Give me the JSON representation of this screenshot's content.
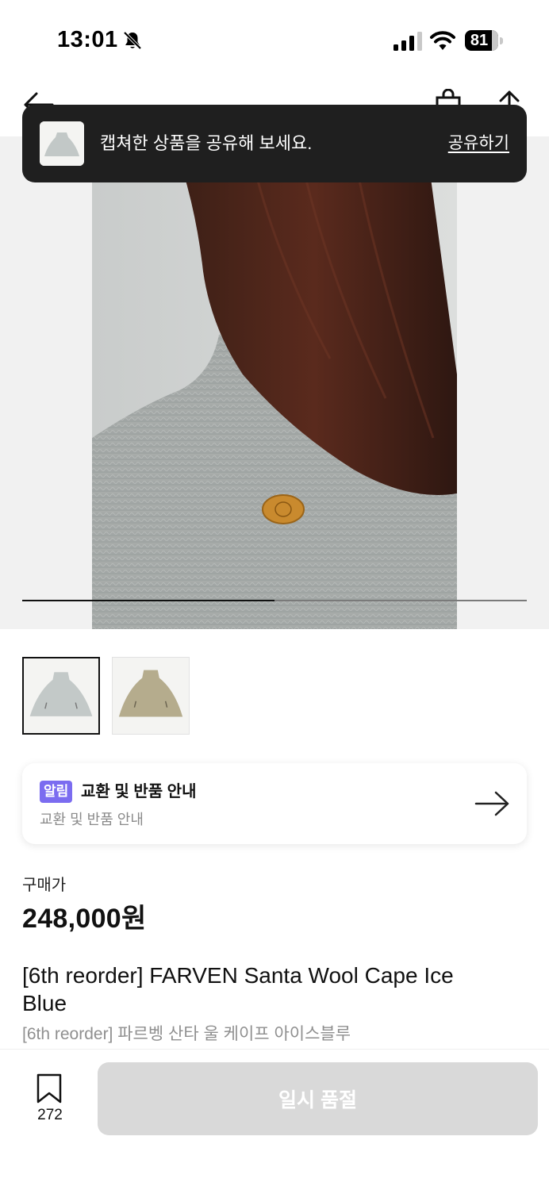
{
  "status_bar": {
    "time": "13:01",
    "battery": "81",
    "battery_level": 0.81
  },
  "nav": {
    "back_icon": "arrow-left-icon",
    "bag_icon": "shopping-bag-icon",
    "share_icon": "share-icon"
  },
  "gallery": {
    "progress": 0.5,
    "thumbnails": [
      {
        "name": "ice-blue-cape",
        "selected": true
      },
      {
        "name": "beige-cape",
        "selected": false
      }
    ]
  },
  "toast": {
    "message": "캡쳐한 상품을 공유해 보세요.",
    "action": "공유하기"
  },
  "notice": {
    "badge": "알림",
    "title": "교환 및 반품 안내",
    "subtitle": "교환 및 반품 안내"
  },
  "product": {
    "price_label": "구매가",
    "price": "248,000원",
    "title": "[6th reorder] FARVEN Santa Wool Cape Ice Blue",
    "subtitle": "[6th reorder] 파르벵 산타 울 케이프 아이스블루"
  },
  "bottom_bar": {
    "bookmark_count": "272",
    "cta_label": "일시 품절"
  },
  "colors": {
    "accent_badge": "#7b6cf0",
    "toast_bg": "#1f1f1f",
    "disabled_button": "#d9d9d9"
  }
}
